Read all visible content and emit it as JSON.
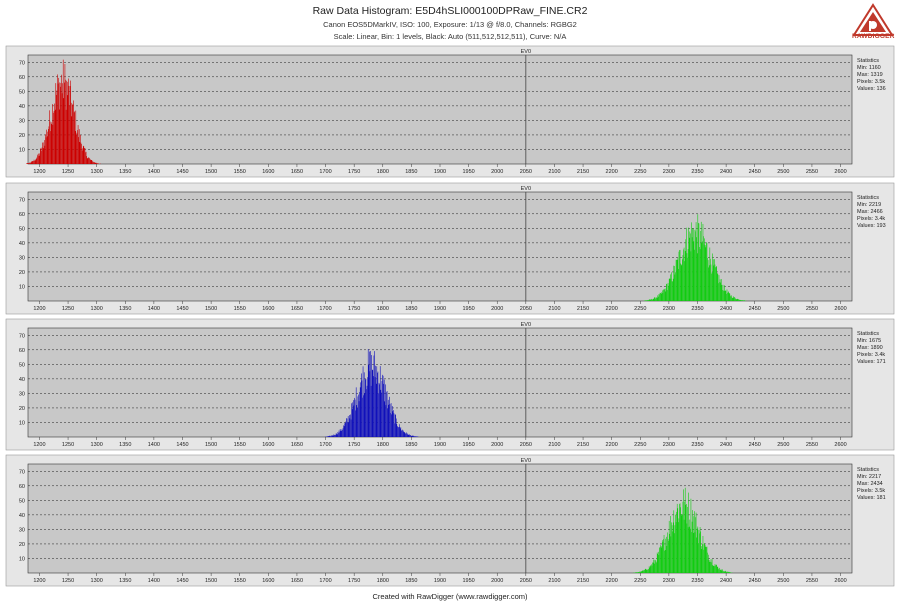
{
  "header": {
    "title": "Raw Data Histogram: E5D4hSLI000100DPRaw_FINE.CR2",
    "subtitle": "Canon EOS5DMarkIV, ISO: 100, Exposure: 1/13 @ f/8.0, Channels: RGBG2",
    "subtitle2": "Scale: Linear, Bin: 1 levels, Black: Auto (511,512,512,511), Curve: N/A",
    "logo_text": "RAWDIGGER"
  },
  "footer": {
    "text": "Created with RawDigger (www.rawdigger.com)"
  },
  "colors": {
    "panel_bg": "#c8c8c8",
    "outer_bg": "#e6e6e6",
    "red": "#cc0000",
    "green": "#11cc11",
    "blue": "#1111bb",
    "gridline": "#222222",
    "ev0_line": "#444444",
    "logo_red": "#c0392b"
  },
  "chart_data": [
    {
      "type": "bar",
      "channel": "R",
      "color": "#cc0000",
      "ev_label": "EV0",
      "ev0_x": 2050,
      "xlim": [
        1180,
        2620
      ],
      "ylim": [
        0,
        75
      ],
      "xticks": [
        1200,
        1250,
        1300,
        1350,
        1400,
        1450,
        1500,
        1550,
        1600,
        1650,
        1700,
        1750,
        1800,
        1850,
        1900,
        1950,
        2000,
        2050,
        2100,
        2150,
        2200,
        2250,
        2300,
        2350,
        2400,
        2450,
        2500,
        2550,
        2600
      ],
      "yticks": [
        10,
        20,
        30,
        40,
        50,
        60,
        70
      ],
      "distribution": {
        "center": 1240,
        "sigma": 20,
        "peak": 70,
        "min": 1160,
        "max": 1319
      },
      "statistics": {
        "title": "Statistics",
        "min": "Min: 1160",
        "max": "Max: 1319",
        "pixels": "Pixels: 3.5k",
        "values": "Values: 136"
      }
    },
    {
      "type": "bar",
      "channel": "G",
      "color": "#11cc11",
      "ev_label": "EV0",
      "ev0_x": 2050,
      "xlim": [
        1180,
        2620
      ],
      "ylim": [
        0,
        75
      ],
      "xticks": [
        1200,
        1250,
        1300,
        1350,
        1400,
        1450,
        1500,
        1550,
        1600,
        1650,
        1700,
        1750,
        1800,
        1850,
        1900,
        1950,
        2000,
        2050,
        2100,
        2150,
        2200,
        2250,
        2300,
        2350,
        2400,
        2450,
        2500,
        2550,
        2600
      ],
      "yticks": [
        10,
        20,
        30,
        40,
        50,
        60,
        70
      ],
      "distribution": {
        "center": 2345,
        "sigma": 28,
        "peak": 58,
        "min": 2219,
        "max": 2466
      },
      "statistics": {
        "title": "Statistics",
        "min": "Min: 2219",
        "max": "Max: 2466",
        "pixels": "Pixels: 3.4k",
        "values": "Values: 193"
      }
    },
    {
      "type": "bar",
      "channel": "B",
      "color": "#1111bb",
      "ev_label": "EV0",
      "ev0_x": 2050,
      "xlim": [
        1180,
        2620
      ],
      "ylim": [
        0,
        75
      ],
      "xticks": [
        1200,
        1250,
        1300,
        1350,
        1400,
        1450,
        1500,
        1550,
        1600,
        1650,
        1700,
        1750,
        1800,
        1850,
        1900,
        1950,
        2000,
        2050,
        2100,
        2150,
        2200,
        2250,
        2300,
        2350,
        2400,
        2450,
        2500,
        2550,
        2600
      ],
      "yticks": [
        10,
        20,
        30,
        40,
        50,
        60,
        70
      ],
      "distribution": {
        "center": 1780,
        "sigma": 25,
        "peak": 60,
        "min": 1675,
        "max": 1890
      },
      "statistics": {
        "title": "Statistics",
        "min": "Min: 1675",
        "max": "Max: 1890",
        "pixels": "Pixels: 3.4k",
        "values": "Values: 171"
      }
    },
    {
      "type": "bar",
      "channel": "G2",
      "color": "#11cc11",
      "ev_label": "EV0",
      "ev0_x": 2050,
      "xlim": [
        1180,
        2620
      ],
      "ylim": [
        0,
        75
      ],
      "xticks": [
        1200,
        1250,
        1300,
        1350,
        1400,
        1450,
        1500,
        1550,
        1600,
        1650,
        1700,
        1750,
        1800,
        1850,
        1900,
        1950,
        2000,
        2050,
        2100,
        2150,
        2200,
        2250,
        2300,
        2350,
        2400,
        2450,
        2500,
        2550,
        2600
      ],
      "yticks": [
        10,
        20,
        30,
        40,
        50,
        60,
        70
      ],
      "distribution": {
        "center": 2325,
        "sigma": 27,
        "peak": 58,
        "min": 2217,
        "max": 2434
      },
      "statistics": {
        "title": "Statistics",
        "min": "Min: 2217",
        "max": "Max: 2434",
        "pixels": "Pixels: 3.5k",
        "values": "Values: 181"
      }
    }
  ]
}
